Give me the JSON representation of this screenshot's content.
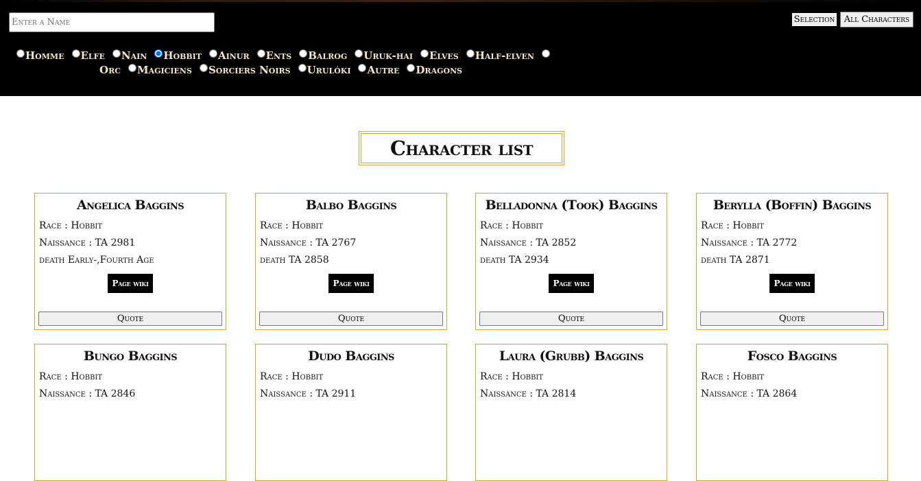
{
  "search": {
    "placeholder": "Enter a Name",
    "value": ""
  },
  "top_buttons": {
    "selection": "Selection",
    "all": "All Characters"
  },
  "races": [
    {
      "label": "Homme",
      "checked": false
    },
    {
      "label": "Elfe",
      "checked": false
    },
    {
      "label": "Nain",
      "checked": false
    },
    {
      "label": "Hobbit",
      "checked": true
    },
    {
      "label": "Ainur",
      "checked": false
    },
    {
      "label": "Ents",
      "checked": false
    },
    {
      "label": "Balrog",
      "checked": false
    },
    {
      "label": "Uruk-hai",
      "checked": false
    },
    {
      "label": "Elves",
      "checked": false
    },
    {
      "label": "Half-elven",
      "checked": false
    },
    {
      "label": "Orc",
      "checked": false
    },
    {
      "label": "Magiciens",
      "checked": false
    },
    {
      "label": "Sorciers Noirs",
      "checked": false
    },
    {
      "label": "Urulóki",
      "checked": false
    },
    {
      "label": "Autre",
      "checked": false
    },
    {
      "label": "Dragons",
      "checked": false
    }
  ],
  "page_title": "Character list",
  "wiki_label": "Page wiki",
  "quote_label": "Quote",
  "characters": [
    {
      "name": "Angelica Baggins",
      "race": "Race : Hobbit",
      "birth": "Naissance : TA 2981",
      "death": "death Early-,Fourth Age"
    },
    {
      "name": "Balbo Baggins",
      "race": "Race : Hobbit",
      "birth": "Naissance : TA 2767",
      "death": "death TA 2858"
    },
    {
      "name": "Belladonna (Took) Baggins",
      "race": "Race : Hobbit",
      "birth": "Naissance : TA 2852",
      "death": "death TA 2934"
    },
    {
      "name": "Berylla (Boffin) Baggins",
      "race": "Race : Hobbit",
      "birth": "Naissance : TA 2772",
      "death": "death TA 2871"
    },
    {
      "name": "Bungo Baggins",
      "race": "Race : Hobbit",
      "birth": "Naissance : TA 2846",
      "death": ""
    },
    {
      "name": "Dudo Baggins",
      "race": "Race : Hobbit",
      "birth": "Naissance : TA 2911",
      "death": ""
    },
    {
      "name": "Laura (Grubb) Baggins",
      "race": "Race : Hobbit",
      "birth": "Naissance : TA 2814",
      "death": ""
    },
    {
      "name": "Fosco Baggins",
      "race": "Race : Hobbit",
      "birth": "Naissance : TA 2864",
      "death": ""
    }
  ]
}
